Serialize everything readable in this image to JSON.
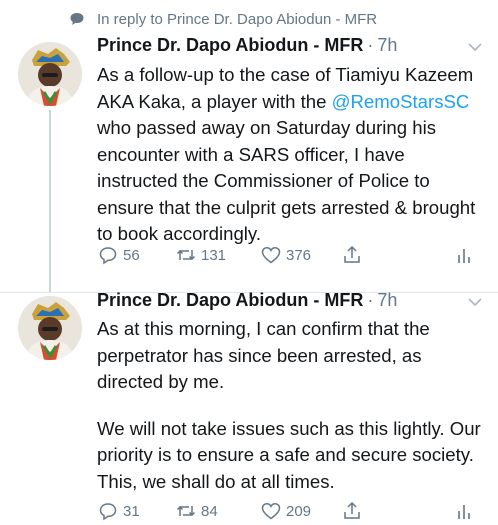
{
  "reply_context": {
    "text": "In reply to Prince Dr. Dapo Abiodun - MFR",
    "icon": "speech-bubble-icon"
  },
  "tweets": [
    {
      "author": "Prince Dr. Dapo Abiodun - MFR",
      "separator": "·",
      "time": "7h",
      "text_before_mention": "As a follow-up to the case of Tiamiyu Kazeem AKA Kaka, a player with the ",
      "mention": "@RemoStarsSC",
      "text_after_mention": " who passed away on Saturday during his encounter with a SARS officer, I have instructed the Commissioner of Police to ensure that the culprit gets arrested & brought to book accordingly.",
      "replies": "56",
      "retweets": "131",
      "likes": "376"
    },
    {
      "author": "Prince Dr. Dapo Abiodun - MFR",
      "separator": "·",
      "time": "7h",
      "paragraph_1": "As at this morning, I can confirm that the perpetrator has since been arrested, as directed by me.",
      "paragraph_2": "We will not take issues such as this lightly. Our priority is to ensure a safe and secure society. This, we shall do at all times.",
      "replies": "31",
      "retweets": "84",
      "likes": "209"
    }
  ],
  "colors": {
    "text": "#14171a",
    "secondary": "#657786",
    "link": "#1da1f2",
    "divider": "#e1e8ed"
  }
}
